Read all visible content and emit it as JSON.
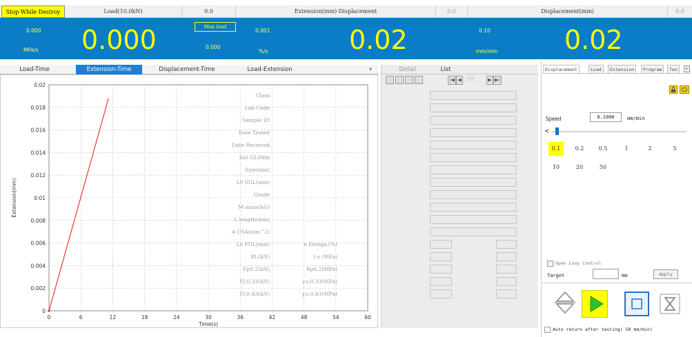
{
  "header": {
    "stop_label": "Stop While Destroy",
    "col1_label": "Load(10.0kN)",
    "col1_value": "0.0",
    "col2_label": "Extension(mm)-Displacement",
    "col2_value": "0.0",
    "col3_label": "Displacement(mm)",
    "col3_value": "0.0"
  },
  "panel": {
    "load_rate": "0.000",
    "load_rate_unit": "MPa/s",
    "load_value": "0.000",
    "max_load_label": "Max load",
    "max_load_value": "0.000",
    "ext_rate": "0.001",
    "ext_rate_unit": "%/s",
    "ext_value": "0.02",
    "disp_rate": "0.10",
    "disp_rate_unit": "mm/min",
    "disp_value": "0.02"
  },
  "chart_tabs": [
    "Load-Time",
    "Extension-Time",
    "Displacement-Time",
    "Load-Extension"
  ],
  "chart_tab_menu": "▾",
  "chart_data": {
    "type": "line",
    "xlabel": "Time(s)",
    "ylabel": "Extension(mm)",
    "xlim": [
      0,
      60
    ],
    "ylim": [
      0,
      0.02
    ],
    "xticks": [
      "0",
      "6",
      "12",
      "18",
      "24",
      "30",
      "36",
      "42",
      "48",
      "54",
      "60"
    ],
    "yticks": [
      "0",
      "0.002",
      "0.004",
      "0.006",
      "0.008",
      "0.01",
      "0.012",
      "0.014",
      "0.016",
      "0.018",
      "0.02"
    ],
    "grid": true,
    "series": [
      {
        "color": "#ee3333",
        "x": [
          0,
          11.2
        ],
        "y": [
          0,
          0.0188
        ]
      }
    ]
  },
  "detail": {
    "tabs": [
      "Detail",
      "List"
    ],
    "page_text": "1/1",
    "nav": {
      "first": "|◀",
      "prev": "◀",
      "next": "▶",
      "last": "▶|"
    },
    "fields": [
      "Class",
      "Lab Code",
      "Sample ID",
      "Date Tested",
      "Date Received",
      "Init GL(Mm",
      "Size(mm)",
      "L0 SGL(mm)",
      "Grade",
      "M mass(kG)",
      "L length(mm)",
      "A CSA(mm^2)"
    ],
    "pair_rows": [
      {
        "l": "Lu FGL(mm)",
        "r": "e Elonga.(%)"
      },
      {
        "l": "RL(kN)",
        "r": "t s (MPa)"
      },
      {
        "l": "Fp0.2(kN)",
        "r": "Rp0.2(MPa)"
      },
      {
        "l": "YL0.33(kN)",
        "r": "y.s.0.33(MPa)"
      },
      {
        "l": "YL0.43(kN)",
        "r": "y.s.0.43(MPa)"
      }
    ]
  },
  "right": {
    "tabs": [
      "Displacement",
      "Load",
      "Extension",
      "Program",
      "Ten"
    ],
    "speed_label": "Speed",
    "speed_value": "0.1000",
    "speed_unit": "mm/min",
    "speeds": [
      "0.1",
      "0.2",
      "0.5",
      "1",
      "2",
      "5",
      "10",
      "20",
      "50"
    ],
    "selected_speed": "0.1",
    "open_loop_label": "Open Loop Control",
    "target_label": "Target",
    "target_unit": "mm",
    "apply_label": "Apply",
    "auto_return_label": "Auto return after testing( 50  mm/min)"
  }
}
